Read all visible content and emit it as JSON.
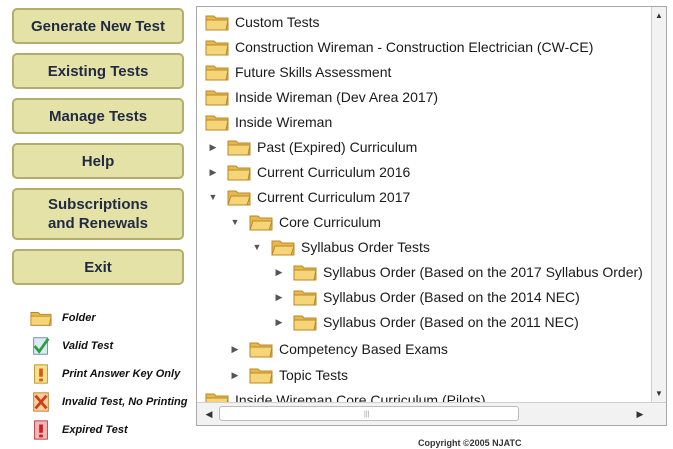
{
  "buttons": {
    "generate": "Generate New Test",
    "existing": "Existing Tests",
    "manage": "Manage Tests",
    "help": "Help",
    "subscriptions_line1": "Subscriptions",
    "subscriptions_line2": "and Renewals",
    "exit": "Exit"
  },
  "legend": {
    "folder": "Folder",
    "valid": "Valid Test",
    "print_key": "Print Answer Key Only",
    "invalid": "Invalid Test, No Printing",
    "expired": "Expired Test"
  },
  "tree": {
    "rows": [
      {
        "label": "Custom Tests",
        "toggle": ""
      },
      {
        "label": "Construction Wireman - Construction Electrician (CW-CE)",
        "toggle": ""
      },
      {
        "label": "Future Skills Assessment",
        "toggle": ""
      },
      {
        "label": "Inside Wireman (Dev Area 2017)",
        "toggle": ""
      },
      {
        "label": "Inside Wireman",
        "toggle": ""
      },
      {
        "label": "Past (Expired) Curriculum",
        "toggle": "▶"
      },
      {
        "label": "Current Curriculum 2016",
        "toggle": "▶"
      },
      {
        "label": "Current Curriculum 2017",
        "toggle": "▼"
      },
      {
        "label": "Core Curriculum",
        "toggle": "▼"
      },
      {
        "label": "Syllabus Order Tests",
        "toggle": "▼"
      },
      {
        "label": "Syllabus Order (Based on the 2017 Syllabus Order)",
        "toggle": "▶"
      },
      {
        "label": "Syllabus Order (Based on the 2014 NEC)",
        "toggle": "▶"
      },
      {
        "label": "Syllabus Order (Based on the 2011 NEC)",
        "toggle": "▶"
      },
      {
        "label": "Competency Based Exams",
        "toggle": "▶"
      },
      {
        "label": "Topic Tests",
        "toggle": "▶"
      },
      {
        "label": "Inside Wireman Core Curriculum (Pilots)",
        "toggle": ""
      }
    ]
  },
  "scroll": {
    "up": "▲",
    "down": "▼",
    "left": "◀",
    "right": "▶",
    "grip": "|||"
  },
  "copyright": "Copyright ©2005 NJATC",
  "colors": {
    "button_bg": "#e4e2a6",
    "button_border": "#b3ad6e",
    "folder": "#f3c75a"
  }
}
